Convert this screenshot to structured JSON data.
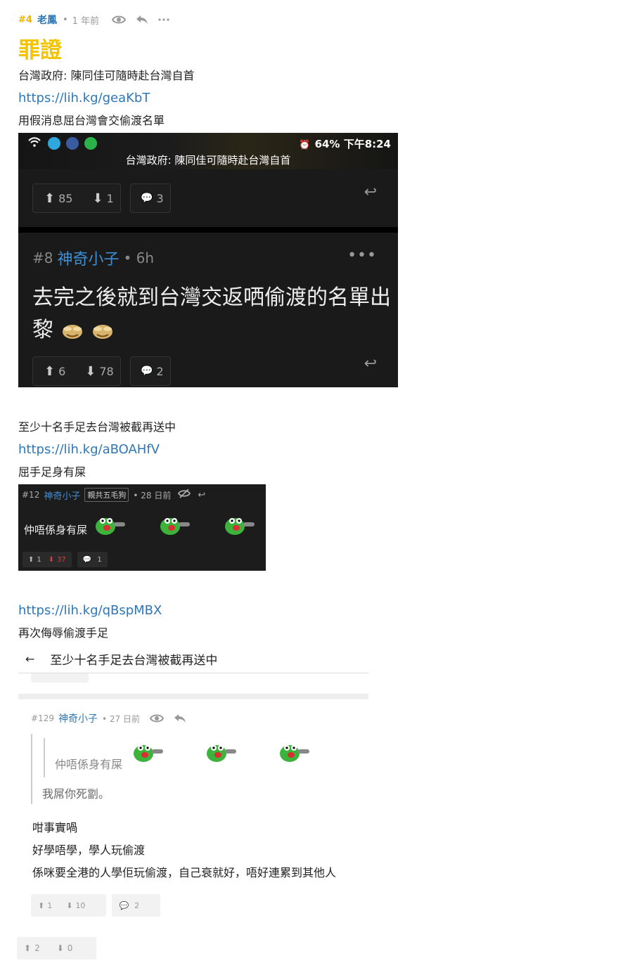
{
  "post": {
    "number": "#4",
    "author": "老鳳",
    "separator": "•",
    "time": "1 年前",
    "title": "罪證",
    "lines": [
      "台灣政府: 陳同佳可隨時赴台灣自首",
      "https://lih.kg/geaKbT",
      "用假消息屈台灣會交偷渡名單",
      "至少十名手足去台灣被截再送中",
      "https://lih.kg/aBOAHfV",
      "屈手足身有屎",
      "https://lih.kg/qBspMBX",
      "再次侮辱偷渡手足"
    ],
    "votes": {
      "up": "2",
      "down": "0"
    }
  },
  "shot1": {
    "battery": "64% 下午8:24",
    "bar_title": "台灣政府: 陳同佳可隨時赴台灣自首",
    "top_votes": {
      "up": "85",
      "down": "1",
      "comments": "3"
    },
    "reply_number": "#8",
    "reply_author": "神奇小子",
    "reply_time": "• 6h",
    "reply_dots": "•••",
    "reply_text": "去完之後就到台灣交返哂偷渡的名單出黎",
    "bottom_votes": {
      "up": "6",
      "down": "78",
      "comments": "2"
    }
  },
  "shot2": {
    "number": "#12",
    "author": "神奇小子",
    "tag": "親共五毛狗",
    "time": "• 28 日前",
    "text": "仲唔係身有屎",
    "votes": {
      "up": "1",
      "down": "37",
      "comments": "1"
    }
  },
  "shot3": {
    "nav_title": "至少十名手足去台灣被截再送中",
    "number": "#129",
    "author": "神奇小子",
    "time": "• 27 日前",
    "quote_inner": "仲唔係身有屎",
    "quote_outer": "我屌你死劏。",
    "body": [
      "咁事實喎",
      "好學唔學，學人玩偷渡",
      "係咪要全港的人學佢玩偷渡，自己衰就好，唔好連累到其他人"
    ],
    "votes": {
      "up": "1",
      "down": "10",
      "comments": "2"
    }
  },
  "colors": {
    "accent": "#f5c400",
    "link": "#2e77b6",
    "down_red": "#e03c3c"
  }
}
